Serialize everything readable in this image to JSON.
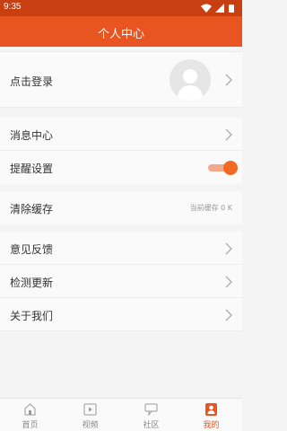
{
  "status_bar": {
    "time": "9:35"
  },
  "header": {
    "title": "个人中心"
  },
  "login": {
    "label": "点击登录"
  },
  "menu": {
    "messages": "消息中心",
    "reminder": "提醒设置",
    "clear_cache": "清除缓存",
    "cache_info": "当前缓存 0 K",
    "feedback": "意见反馈",
    "check_update": "检测更新",
    "about": "关于我们"
  },
  "reminder_toggle": {
    "on": true
  },
  "bottom_nav": {
    "home": "首页",
    "video": "视频",
    "community": "社区",
    "mine": "我的"
  },
  "colors": {
    "accent": "#e85520",
    "status_bar": "#c83f12"
  }
}
